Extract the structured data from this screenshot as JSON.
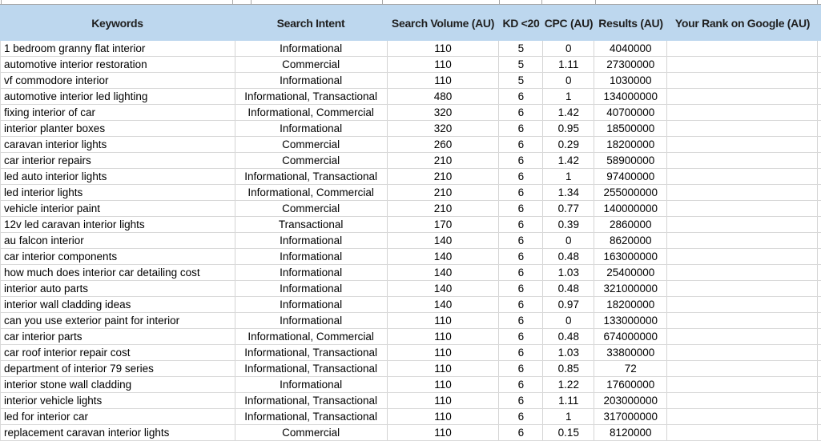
{
  "colors": {
    "header_bg": "#BDD7EE",
    "grid_line": "#D4D4D4",
    "row_line": "#D9D9D9",
    "text": "#000000",
    "header_text": "#1F1F1F"
  },
  "table": {
    "columns": [
      {
        "label": "Keywords",
        "align": "left"
      },
      {
        "label": "Search Intent",
        "align": "center"
      },
      {
        "label": "Search Volume (AU)",
        "align": "center"
      },
      {
        "label": "KD <20",
        "align": "center"
      },
      {
        "label": "CPC (AU)",
        "align": "center"
      },
      {
        "label": "Results (AU)",
        "align": "center"
      },
      {
        "label": "Your Rank on Google (AU)",
        "align": "center"
      }
    ],
    "rows": [
      [
        "1 bedroom granny flat interior",
        "Informational",
        "110",
        "5",
        "0",
        "4040000",
        ""
      ],
      [
        "automotive interior restoration",
        "Commercial",
        "110",
        "5",
        "1.11",
        "27300000",
        ""
      ],
      [
        "vf commodore interior",
        "Informational",
        "110",
        "5",
        "0",
        "1030000",
        ""
      ],
      [
        "automotive interior led lighting",
        "Informational, Transactional",
        "480",
        "6",
        "1",
        "134000000",
        ""
      ],
      [
        "fixing interior of car",
        "Informational, Commercial",
        "320",
        "6",
        "1.42",
        "40700000",
        ""
      ],
      [
        "interior planter boxes",
        "Informational",
        "320",
        "6",
        "0.95",
        "18500000",
        ""
      ],
      [
        "caravan interior lights",
        "Commercial",
        "260",
        "6",
        "0.29",
        "18200000",
        ""
      ],
      [
        "car interior repairs",
        "Commercial",
        "210",
        "6",
        "1.42",
        "58900000",
        ""
      ],
      [
        "led auto interior lights",
        "Informational, Transactional",
        "210",
        "6",
        "1",
        "97400000",
        ""
      ],
      [
        "led interior lights",
        "Informational, Commercial",
        "210",
        "6",
        "1.34",
        "255000000",
        ""
      ],
      [
        "vehicle interior paint",
        "Commercial",
        "210",
        "6",
        "0.77",
        "140000000",
        ""
      ],
      [
        "12v led caravan interior lights",
        "Transactional",
        "170",
        "6",
        "0.39",
        "2860000",
        ""
      ],
      [
        "au falcon interior",
        "Informational",
        "140",
        "6",
        "0",
        "8620000",
        ""
      ],
      [
        "car interior components",
        "Informational",
        "140",
        "6",
        "0.48",
        "163000000",
        ""
      ],
      [
        "how much does interior car detailing cost",
        "Informational",
        "140",
        "6",
        "1.03",
        "25400000",
        ""
      ],
      [
        "interior auto parts",
        "Informational",
        "140",
        "6",
        "0.48",
        "321000000",
        ""
      ],
      [
        "interior wall cladding ideas",
        "Informational",
        "140",
        "6",
        "0.97",
        "18200000",
        ""
      ],
      [
        "can you use exterior paint for interior",
        "Informational",
        "110",
        "6",
        "0",
        "133000000",
        ""
      ],
      [
        "car interior parts",
        "Informational, Commercial",
        "110",
        "6",
        "0.48",
        "674000000",
        ""
      ],
      [
        "car roof interior repair cost",
        "Informational, Transactional",
        "110",
        "6",
        "1.03",
        "33800000",
        ""
      ],
      [
        "department of interior 79 series",
        "Informational, Transactional",
        "110",
        "6",
        "0.85",
        "72",
        ""
      ],
      [
        "interior stone wall cladding",
        "Informational",
        "110",
        "6",
        "1.22",
        "17600000",
        ""
      ],
      [
        "interior vehicle lights",
        "Informational, Transactional",
        "110",
        "6",
        "1.11",
        "203000000",
        ""
      ],
      [
        "led for interior car",
        "Informational, Transactional",
        "110",
        "6",
        "1",
        "317000000",
        ""
      ],
      [
        "replacement caravan interior lights",
        "Commercial",
        "110",
        "6",
        "0.15",
        "8120000",
        ""
      ]
    ]
  }
}
